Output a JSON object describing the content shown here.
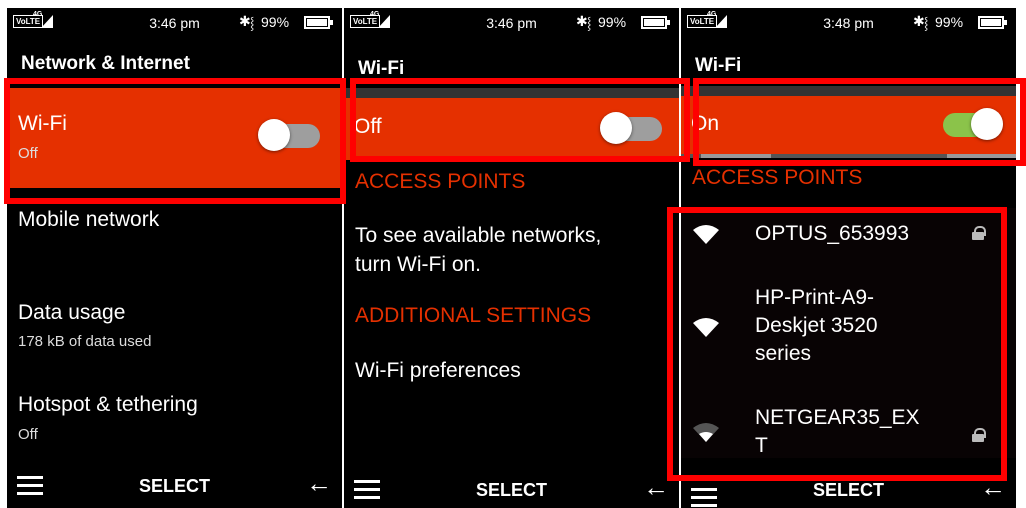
{
  "colors": {
    "accent": "#e53000",
    "highlight": "#ff0000",
    "toggle_on": "#8bc34a",
    "toggle_off": "#9e9e9e",
    "background": "#000000"
  },
  "screens": [
    {
      "status": {
        "volte": "VoLTE",
        "network": "4G",
        "time": "3:46 pm",
        "battery": "99%"
      },
      "title": "Network & Internet",
      "items": [
        {
          "label": "Wi-Fi",
          "sub": "Off",
          "toggle": "off",
          "selected": true
        },
        {
          "label": "Mobile network"
        },
        {
          "label": "Data usage",
          "sub": "178 kB of data used"
        },
        {
          "label": "Hotspot & tethering",
          "sub": "Off"
        }
      ],
      "softkeys": {
        "left": "menu-icon",
        "center": "SELECT",
        "right": "back-arrow-icon"
      }
    },
    {
      "status": {
        "volte": "VoLTE",
        "network": "4G",
        "time": "3:46 pm",
        "battery": "99%"
      },
      "title": "Wi-Fi",
      "toggle_row": {
        "label": "Off",
        "toggle": "off"
      },
      "sections": {
        "access_points": "ACCESS POINTS",
        "additional": "ADDITIONAL SETTINGS"
      },
      "hint_line1": "To see available networks,",
      "hint_line2": "turn Wi-Fi on.",
      "preferences": "Wi-Fi preferences",
      "softkeys": {
        "left": "menu-icon",
        "center": "SELECT",
        "right": "back-arrow-icon"
      }
    },
    {
      "status": {
        "volte": "VoLTE",
        "network": "4G",
        "time": "3:48 pm",
        "battery": "99%"
      },
      "title": "Wi-Fi",
      "toggle_row": {
        "label": "On",
        "toggle": "on"
      },
      "sections": {
        "access_points": "ACCESS POINTS"
      },
      "access_points": [
        {
          "name": "OPTUS_653993",
          "locked": true,
          "signal": "full"
        },
        {
          "line1": "HP-Print-A9-",
          "line2": "Deskjet 3520",
          "line3": "series",
          "locked": false,
          "signal": "full"
        },
        {
          "line1": "NETGEAR35_EX",
          "line2": "T",
          "locked": true,
          "signal": "weak"
        }
      ],
      "softkeys": {
        "left": "menu-icon",
        "center": "SELECT",
        "right": "back-arrow-icon"
      }
    }
  ]
}
